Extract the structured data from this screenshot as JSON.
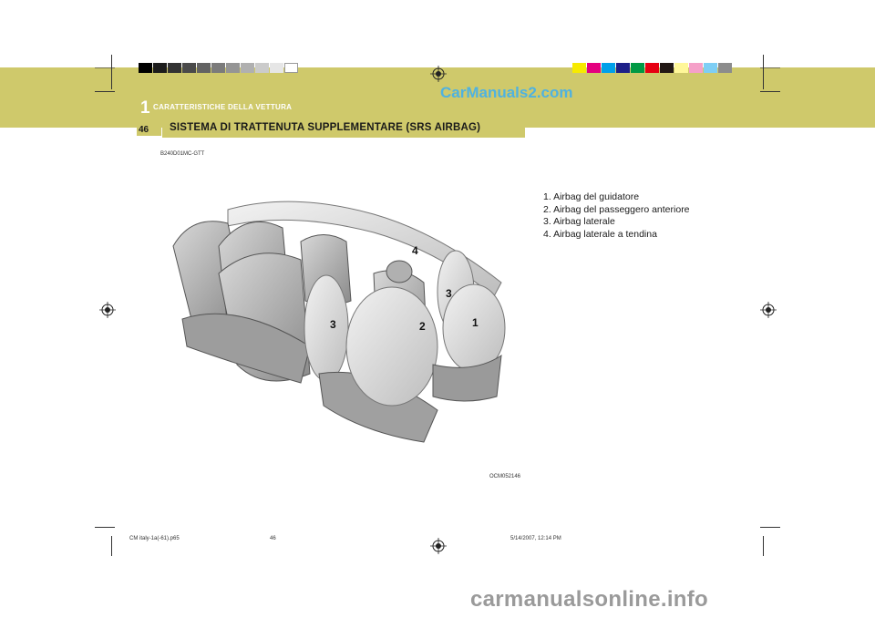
{
  "watermark_top": "CarManuals2.com",
  "header": {
    "chapter_number": "1",
    "chapter_title": "CARATTERISTICHE DELLA VETTURA",
    "page_number": "46",
    "section_title": "SISTEMA DI TRATTENUTA SUPPLEMENTARE (SRS AIRBAG)"
  },
  "doc_code": "B240D01MC-GTT",
  "legend": [
    "1. Airbag del guidatore",
    "2. Airbag del passeggero anteriore",
    "3. Airbag laterale",
    "4. Airbag laterale a tendina"
  ],
  "figure": {
    "code": "OCM052146",
    "callouts": [
      "1",
      "2",
      "3",
      "3",
      "4"
    ]
  },
  "footer": {
    "file": "CM italy-1a(-61).p65",
    "page": "46",
    "date": "5/14/2007, 12:14 PM"
  },
  "bottom_watermark": "carmanualsonline.info",
  "colors": {
    "band": "#cfc96b",
    "watermark_top": "#4fb2e0",
    "swatches_left": [
      "#000000",
      "#1c1c1c",
      "#333333",
      "#4a4a4a",
      "#636363",
      "#7b7b7b",
      "#959595",
      "#b0b0b0",
      "#cbcbcb",
      "#e6e6e6",
      "#ffffff"
    ],
    "swatches_right": [
      "#f7ea00",
      "#e4007f",
      "#00a0e9",
      "#1d2088",
      "#009944",
      "#e60012",
      "#231815",
      "#fff799",
      "#f5a0c8",
      "#7ecef4",
      "#8c8c8c"
    ]
  }
}
